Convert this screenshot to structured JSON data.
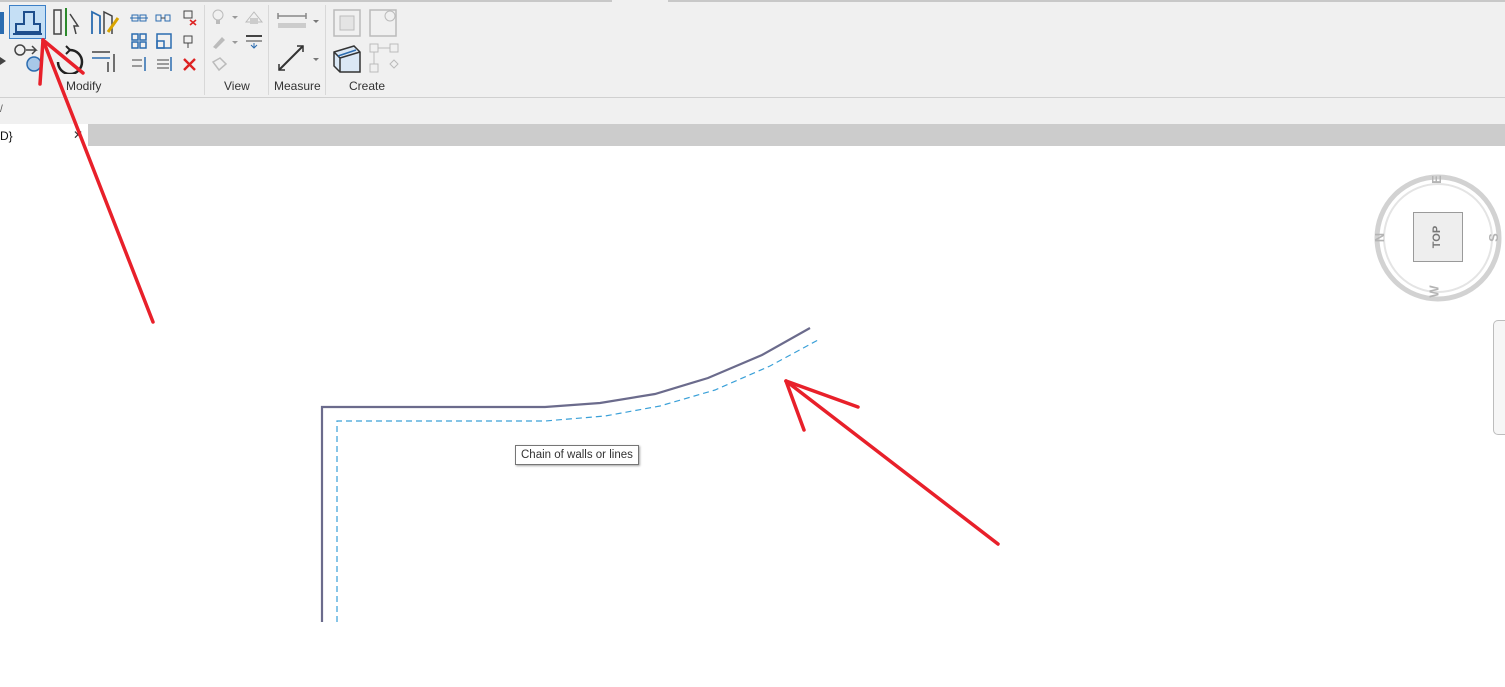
{
  "ribbon": {
    "panels": [
      {
        "label": "Modify"
      },
      {
        "label": "View"
      },
      {
        "label": "Measure"
      },
      {
        "label": "Create"
      }
    ]
  },
  "view_tab": {
    "title": "D}",
    "close_glyph": "✕"
  },
  "options_bar": {
    "glyph": "/"
  },
  "canvas": {
    "tooltip": "Chain of walls or lines"
  },
  "viewcube": {
    "face": "TOP",
    "compass": {
      "north": "N",
      "east": "E",
      "south": "S",
      "west": "W"
    }
  },
  "colors": {
    "annotation_arrow": "#e8202a",
    "wall_line": "#6b6b8c",
    "offset_line": "#3aa0d8",
    "active_tool": "#c5dff5"
  },
  "icons": {
    "offset_tool": "offset-icon",
    "align_tool": "align-icon",
    "split_tool": "split-icon"
  }
}
